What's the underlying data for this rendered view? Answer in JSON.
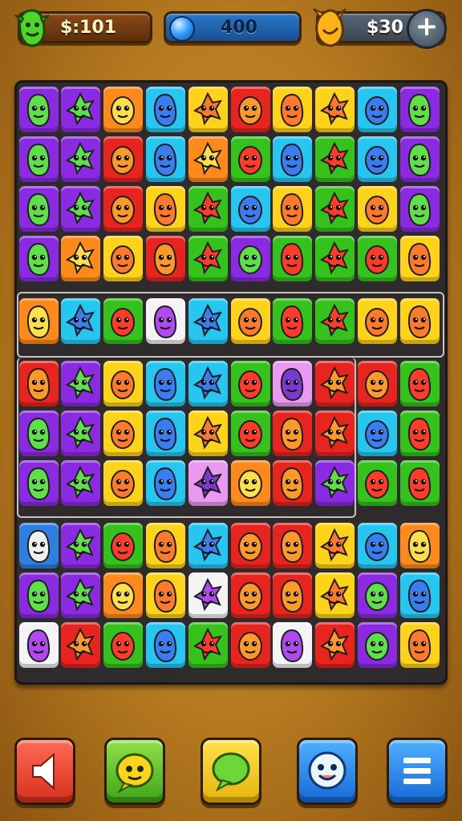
{
  "hud": {
    "money_text": "$:101",
    "energy_text": "400",
    "coins_text": "$30",
    "plus_label": "+",
    "icons": [
      "green-creature-icon",
      "energy-orb-icon",
      "coin-leaf-icon",
      "plus-icon"
    ]
  },
  "board": {
    "rows": [
      [
        "purple",
        "purple",
        "orange",
        "cyan",
        "yellow",
        "red",
        "yellow",
        "yellow",
        "cyan",
        "purple"
      ],
      [
        "purple",
        "purple",
        "red",
        "cyan",
        "orange",
        "green",
        "cyan",
        "green",
        "cyan",
        "purple"
      ],
      [
        "purple",
        "purple",
        "red",
        "yellow",
        "green",
        "cyan",
        "yellow",
        "green",
        "yellow",
        "purple"
      ],
      [
        "purple",
        "orange",
        "yellow",
        "red",
        "green",
        "purple",
        "green",
        "green",
        "green",
        "yellow"
      ],
      [
        "orange",
        "cyan",
        "green",
        "white",
        "cyan",
        "yellow",
        "green",
        "green",
        "yellow",
        "yellow"
      ],
      [
        "red",
        "purple",
        "yellow",
        "cyan",
        "cyan",
        "green",
        "pink",
        "red",
        "red",
        "green"
      ],
      [
        "purple",
        "purple",
        "yellow",
        "cyan",
        "yellow",
        "green",
        "red",
        "red",
        "cyan",
        "green"
      ],
      [
        "purple",
        "purple",
        "yellow",
        "cyan",
        "pink",
        "orange",
        "red",
        "purple",
        "green",
        "green"
      ],
      [
        "blue",
        "purple",
        "green",
        "yellow",
        "cyan",
        "red",
        "red",
        "yellow",
        "cyan",
        "orange"
      ],
      [
        "purple",
        "purple",
        "orange",
        "yellow",
        "white",
        "red",
        "red",
        "yellow",
        "purple",
        "cyan"
      ],
      [
        "white",
        "red",
        "green",
        "cyan",
        "green",
        "red",
        "white",
        "red",
        "purple",
        "yellow"
      ]
    ],
    "palette": {
      "purple": "#8a2be2",
      "orange": "#ff8a1c",
      "cyan": "#27c6f0",
      "yellow": "#ffd31a",
      "red": "#e8241f",
      "green": "#35c21d",
      "white": "#f4f4f4",
      "pink": "#e99af0",
      "blue": "#2f7fe0"
    },
    "creature_colors": {
      "purple": "#5fe04a",
      "orange": "#ffe04a",
      "cyan": "#3a7df0",
      "yellow": "#ff7a2a",
      "red": "#ff9a2a",
      "green": "#ff3c2a",
      "white": "#b04af0",
      "pink": "#7a3ad0",
      "blue": "#f0f0f0"
    }
  },
  "buttons": [
    {
      "name": "back-button",
      "icon": "speaker-left-arrow-icon"
    },
    {
      "name": "hint-button",
      "icon": "green-smiley-bubble-icon"
    },
    {
      "name": "chat-button",
      "icon": "speech-bubble-icon"
    },
    {
      "name": "profile-button",
      "icon": "smiley-face-icon"
    },
    {
      "name": "menu-button",
      "icon": "hamburger-menu-icon"
    }
  ]
}
